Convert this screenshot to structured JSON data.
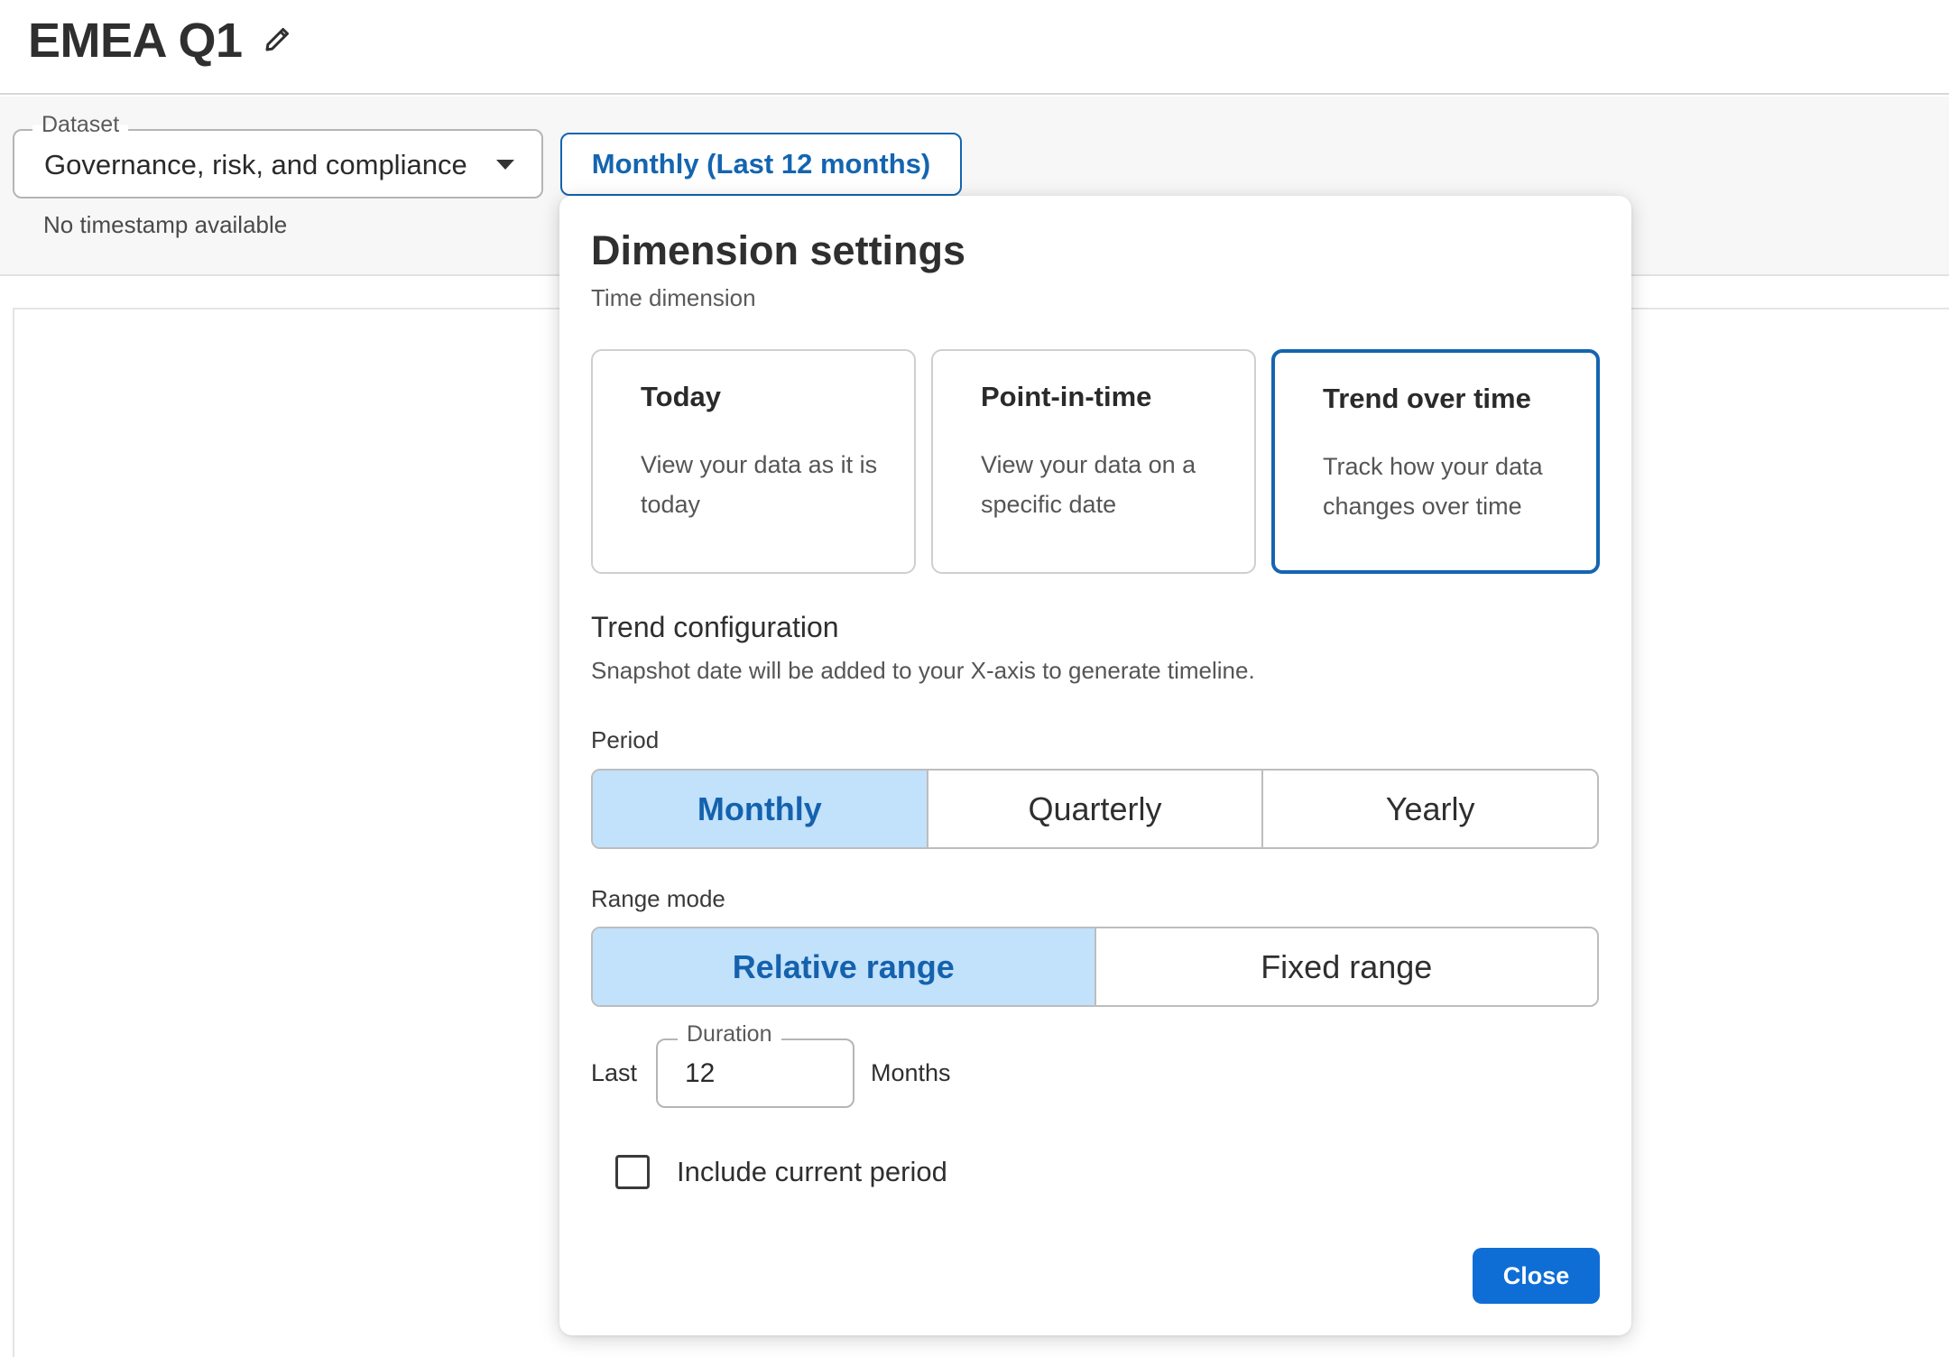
{
  "header": {
    "title": "EMEA Q1",
    "edit_icon": "pencil-icon"
  },
  "filters": {
    "dataset": {
      "label": "Dataset",
      "value": "Governance, risk, and compliance",
      "caret_icon": "caret-down-icon"
    },
    "timestamp_note": "No timestamp available",
    "period_chip": "Monthly (Last 12 months)"
  },
  "dimension_settings": {
    "title": "Dimension settings",
    "subtitle": "Time dimension",
    "modes": [
      {
        "title": "Today",
        "description": "View your data as it is today",
        "selected": false
      },
      {
        "title": "Point-in-time",
        "description": "View your data on a specific date",
        "selected": false
      },
      {
        "title": "Trend over time",
        "description": "Track how your data changes over time",
        "selected": true
      }
    ],
    "trend": {
      "heading": "Trend configuration",
      "description": "Snapshot date will be added to your X-axis to generate timeline.",
      "period": {
        "label": "Period",
        "options": [
          "Monthly",
          "Quarterly",
          "Yearly"
        ],
        "selected": "Monthly"
      },
      "range_mode": {
        "label": "Range mode",
        "options": [
          "Relative range",
          "Fixed range"
        ],
        "selected": "Relative range"
      },
      "duration": {
        "prefix": "Last",
        "label": "Duration",
        "value": "12",
        "unit": "Months"
      },
      "include_current_period": {
        "label": "Include current period",
        "checked": false
      }
    },
    "close_label": "Close"
  },
  "colors": {
    "accent": "#1465b0",
    "segment_active_bg": "#c2e1fb",
    "primary_button": "#0f6ed5"
  }
}
